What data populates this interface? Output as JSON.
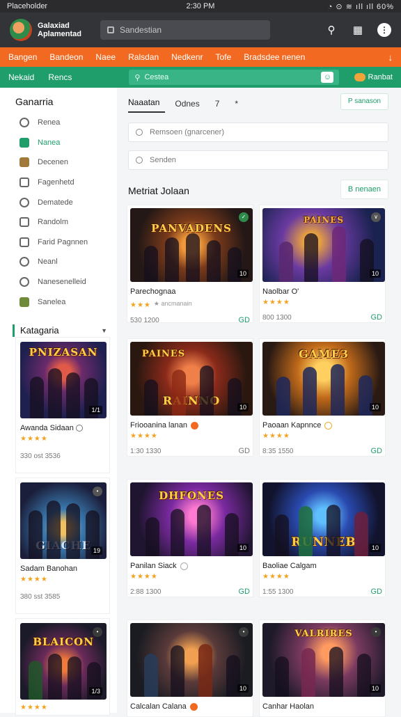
{
  "status": {
    "left": "Placeholder",
    "time": "2:30 PM",
    "right": "◔ ⊙ ≋ ıll ıll 60%"
  },
  "app": {
    "title": "Galaxiad Aplamentad",
    "search_placeholder": "Sandestian"
  },
  "orange_nav": {
    "items": [
      "Bangen",
      "Bandeon",
      "Naee",
      "Ralsdan",
      "Nedkenr",
      "Tofe",
      "Bradsdee nenen"
    ]
  },
  "green_nav": {
    "items": [
      "Nekaid",
      "Rencs"
    ],
    "search_placeholder": "Cestea",
    "right_link": "Ranbat"
  },
  "sidebar": {
    "title": "Ganarria",
    "items": [
      {
        "label": "Renea",
        "icon": "lock-icon"
      },
      {
        "label": "Nanea",
        "icon": "bookmark-icon"
      },
      {
        "label": "Decenen",
        "icon": "image-icon"
      },
      {
        "label": "Fagenhetd",
        "icon": "grid-icon"
      },
      {
        "label": "Dematede",
        "icon": "tools-icon"
      },
      {
        "label": "Randolm",
        "icon": "house-icon"
      },
      {
        "label": "Farid Pagnnen",
        "icon": "document-icon"
      },
      {
        "label": "Neanl",
        "icon": "gauge-icon"
      },
      {
        "label": "Nanesenelleid",
        "icon": "disc-icon"
      },
      {
        "label": "Sanelea",
        "icon": "leaf-icon"
      }
    ],
    "category_label": "Katagaria",
    "cards": [
      {
        "logo": "PNIZASAN",
        "title": "Awanda Sidaan",
        "stars": "★★★★",
        "meta": "330 ost 3536",
        "badge": "1/1"
      },
      {
        "logo": "GIACHE",
        "title": "Sadam Banohan",
        "stars": "★★★★",
        "meta": "380 sst 3585",
        "badge": "19"
      },
      {
        "logo": "BLAICON",
        "title": "",
        "stars": "★★★★",
        "meta": "",
        "badge": "1/3"
      }
    ]
  },
  "main": {
    "tabs": [
      "Naaatan",
      "Odnes",
      "7",
      "*"
    ],
    "tab_button": "P sanason",
    "field1_placeholder": "Remsoen (gnarcener)",
    "field2_placeholder": "Senden",
    "section_title": "Metriat Jolaan",
    "section_button": "B nenaen",
    "cards": [
      {
        "logo": "PANVADENS",
        "title": "Parechognaa",
        "stars": "★★★",
        "small": "★ ancmanain",
        "meta": "530 1200",
        "gd": "GD",
        "badge": "10"
      },
      {
        "logo": "",
        "title": "Naolbar O'",
        "stars": "★★★★",
        "small": "",
        "meta": "800 1300",
        "gd": "GD",
        "badge": "10"
      },
      {
        "logo": "PAINES",
        "logo2": "RAINNO",
        "title": "Friooanina lanan",
        "stars": "★★★★",
        "small": "",
        "meta": "1:30 1330",
        "gd": "GD",
        "badge": "10"
      },
      {
        "logo": "GAME3",
        "title": "Paoaan Kapnnce",
        "stars": "★★★★",
        "small": "",
        "meta": "8:35 1550",
        "gd": "GD",
        "badge": "10"
      },
      {
        "logo": "DHFONES",
        "title": "Panilan Siack",
        "stars": "★★★★",
        "small": "",
        "meta": "2:88 1300",
        "gd": "GD",
        "badge": "10"
      },
      {
        "logo": "RUNNEB",
        "title": "Baoliae Calgam",
        "stars": "★★★★",
        "small": "",
        "meta": "1:55 1300",
        "gd": "GD",
        "badge": "10"
      },
      {
        "logo": "",
        "title": "Calcalan Calana",
        "stars": "",
        "small": "",
        "meta": "",
        "gd": "",
        "badge": "10"
      },
      {
        "logo": "VALRIRES",
        "title": "Canhar Haolan",
        "stars": "",
        "small": "",
        "meta": "",
        "gd": "",
        "badge": "10"
      }
    ]
  }
}
